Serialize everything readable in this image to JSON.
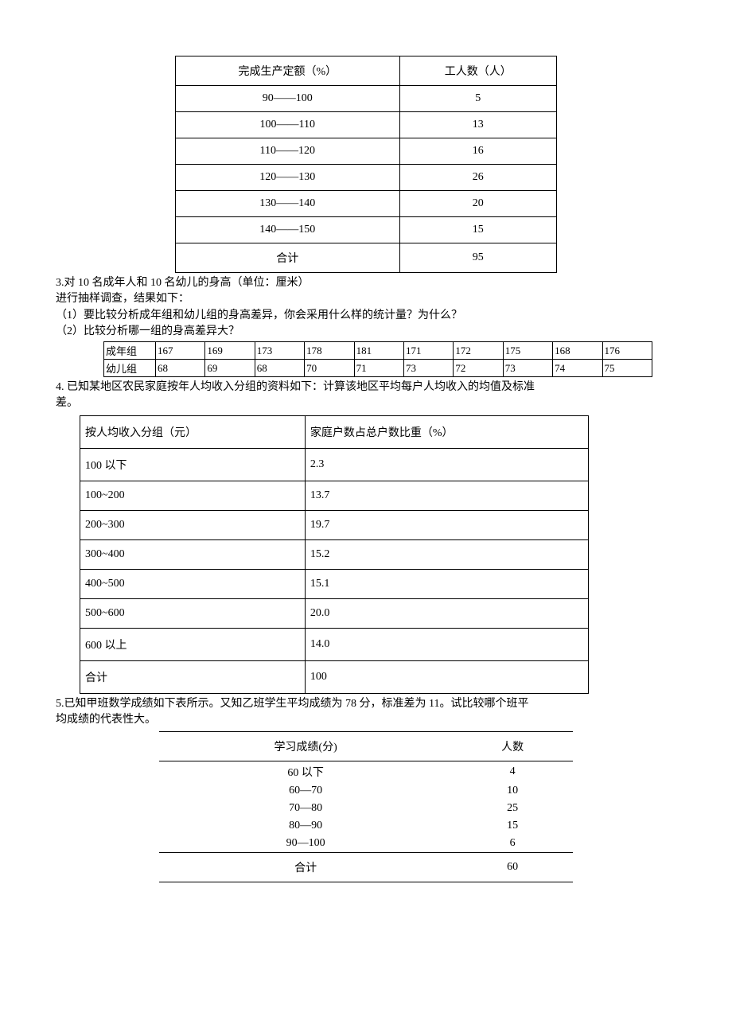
{
  "chart_data": [
    {
      "type": "table",
      "headers": [
        "完成生产定额（%）",
        "工人数（人）"
      ],
      "rows": [
        [
          "90——100",
          "5"
        ],
        [
          "100——110",
          "13"
        ],
        [
          "110——120",
          "16"
        ],
        [
          "120——130",
          "26"
        ],
        [
          "130——140",
          "20"
        ],
        [
          "140——150",
          "15"
        ],
        [
          "合计",
          "95"
        ]
      ]
    },
    {
      "type": "table",
      "row_labels": [
        "成年组",
        "幼儿组"
      ],
      "rows": [
        [
          "167",
          "169",
          "173",
          "178",
          "181",
          "171",
          "172",
          "175",
          "168",
          "176"
        ],
        [
          "68",
          "69",
          "68",
          "70",
          "71",
          "73",
          "72",
          "73",
          "74",
          "75"
        ]
      ]
    },
    {
      "type": "table",
      "headers": [
        "按人均收入分组（元）",
        "家庭户数占总户数比重（%）"
      ],
      "rows": [
        [
          "100 以下",
          "2.3"
        ],
        [
          "100~200",
          "13.7"
        ],
        [
          "200~300",
          "19.7"
        ],
        [
          "300~400",
          "15.2"
        ],
        [
          "400~500",
          "15.1"
        ],
        [
          "500~600",
          "20.0"
        ],
        [
          "600 以上",
          "14.0"
        ],
        [
          "合计",
          "100"
        ]
      ]
    },
    {
      "type": "table",
      "headers": [
        "学习成绩(分)",
        "人数"
      ],
      "rows": [
        [
          "60 以下",
          "4"
        ],
        [
          "60—70",
          "10"
        ],
        [
          "70—80",
          "25"
        ],
        [
          "80—90",
          "15"
        ],
        [
          "90—100",
          "6"
        ]
      ],
      "footer": [
        "合计",
        "60"
      ]
    }
  ],
  "q3": {
    "title": "3.对 10 名成年人和 10 名幼儿的身高（单位：厘米）",
    "line2": "进行抽样调查，结果如下：",
    "sub1": "（1）要比较分析成年组和幼儿组的身高差异，你会采用什么样的统计量？为什么？",
    "sub2": "（2）比较分析哪一组的身高差异大？"
  },
  "q4": {
    "text1": "4. 已知某地区农民家庭按年人均收入分组的资料如下：计算该地区平均每户人均收入的均值及标准",
    "text2": "差。"
  },
  "q5": {
    "text1": "5.已知甲班数学成绩如下表所示。又知乙班学生平均成绩为 78 分，标准差为 11。试比较哪个班平",
    "text2": "均成绩的代表性大。"
  }
}
